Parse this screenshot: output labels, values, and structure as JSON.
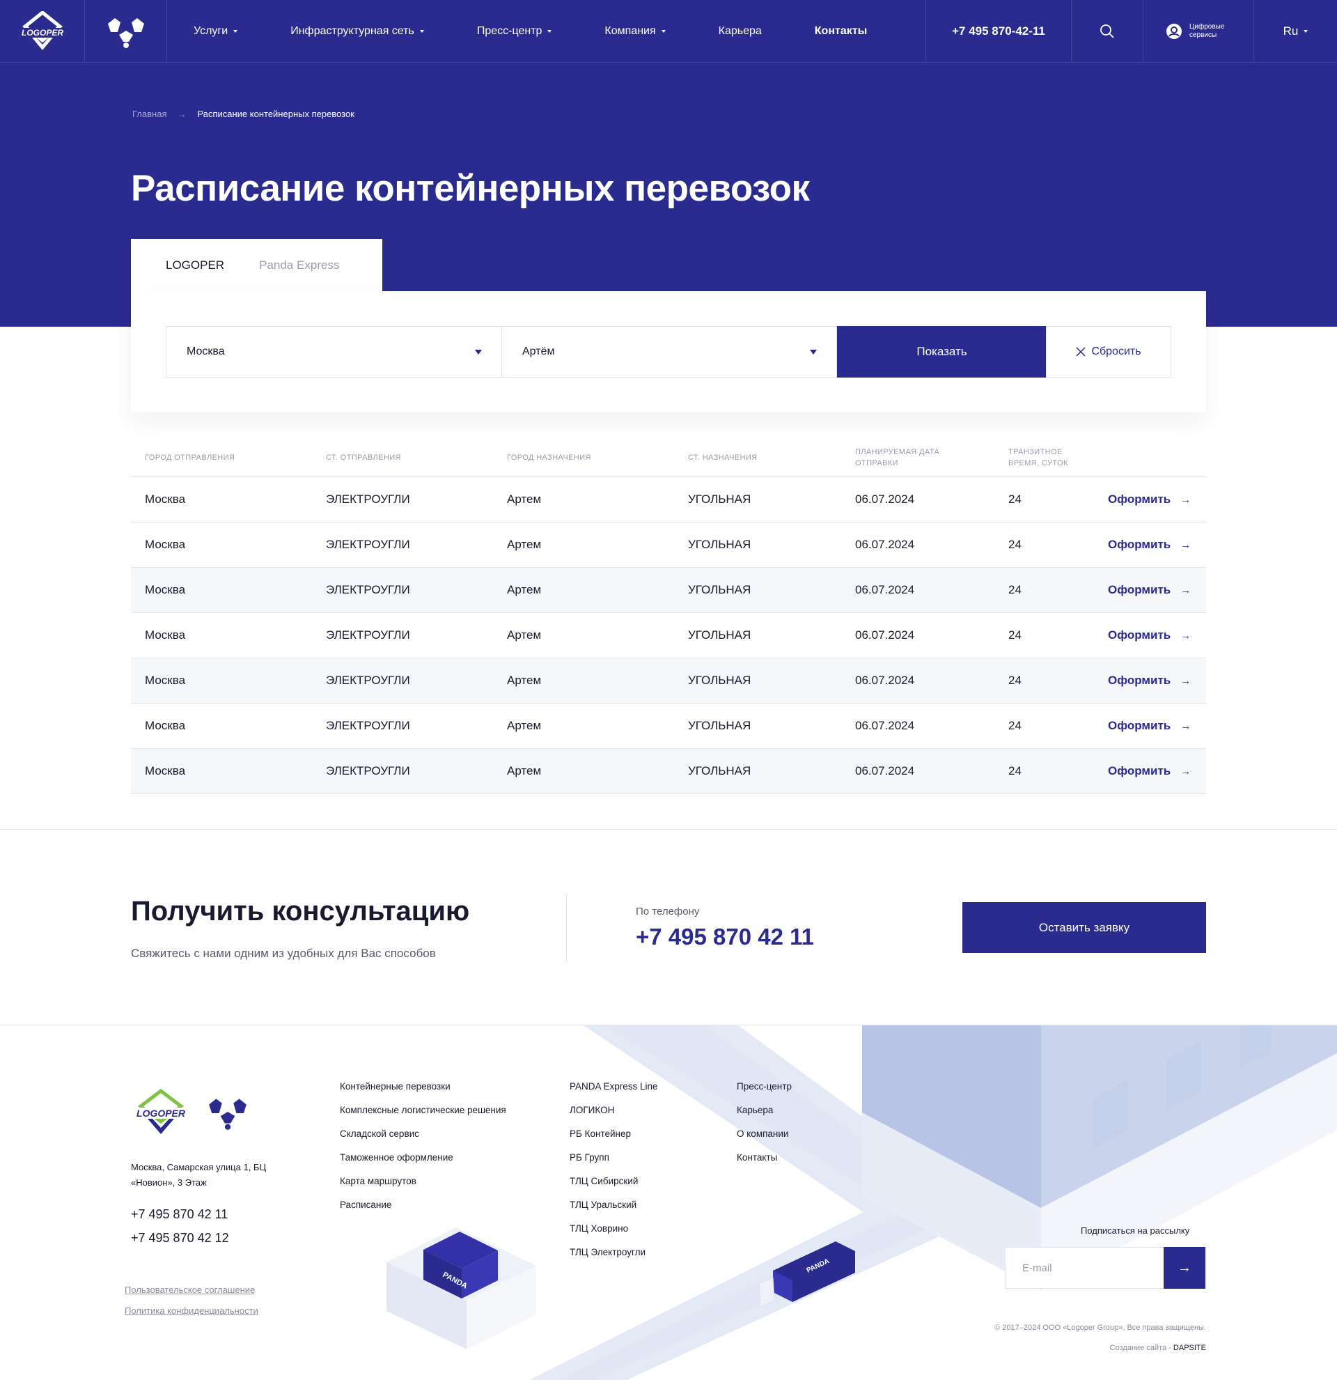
{
  "colors": {
    "brand": "#2b2a8f",
    "accent_green": "#7dc242"
  },
  "header": {
    "logo_text": "LOGOPER",
    "nav": [
      {
        "label": "Услуги",
        "dropdown": true
      },
      {
        "label": "Инфраструктурная сеть",
        "dropdown": true
      },
      {
        "label": "Пресс-центр",
        "dropdown": true
      },
      {
        "label": "Компания",
        "dropdown": true
      },
      {
        "label": "Карьера",
        "dropdown": false
      },
      {
        "label": "Контакты",
        "dropdown": false
      }
    ],
    "phone": "+7 495 870-42-11",
    "search_icon": "search-icon",
    "digital_services": "Цифровые сервисы",
    "lang": "Ru"
  },
  "breadcrumb": {
    "home": "Главная",
    "current": "Расписание контейнерных перевозок"
  },
  "page_title": "Расписание контейнерных перевозок",
  "tabs": [
    {
      "label": "LOGOPER",
      "active": true
    },
    {
      "label": "Panda Express",
      "active": false
    }
  ],
  "filter": {
    "from_value": "Москва",
    "to_value": "Артём",
    "show_label": "Показать",
    "reset_label": "Сбросить"
  },
  "table": {
    "headers": [
      "Город отправления",
      "Ст. отправления",
      "Город назначения",
      "Ст. назначения",
      "Планируемая дата отправки",
      "Транзитное время, суток"
    ],
    "action_label": "Оформить",
    "rows": [
      [
        "Москва",
        "ЭЛЕКТРОУГЛИ",
        "Артем",
        "УГОЛЬНАЯ",
        "06.07.2024",
        "24"
      ],
      [
        "Москва",
        "ЭЛЕКТРОУГЛИ",
        "Артем",
        "УГОЛЬНАЯ",
        "06.07.2024",
        "24"
      ],
      [
        "Москва",
        "ЭЛЕКТРОУГЛИ",
        "Артем",
        "УГОЛЬНАЯ",
        "06.07.2024",
        "24"
      ],
      [
        "Москва",
        "ЭЛЕКТРОУГЛИ",
        "Артем",
        "УГОЛЬНАЯ",
        "06.07.2024",
        "24"
      ],
      [
        "Москва",
        "ЭЛЕКТРОУГЛИ",
        "Артем",
        "УГОЛЬНАЯ",
        "06.07.2024",
        "24"
      ],
      [
        "Москва",
        "ЭЛЕКТРОУГЛИ",
        "Артем",
        "УГОЛЬНАЯ",
        "06.07.2024",
        "24"
      ],
      [
        "Москва",
        "ЭЛЕКТРОУГЛИ",
        "Артем",
        "УГОЛЬНАЯ",
        "06.07.2024",
        "24"
      ]
    ]
  },
  "consult": {
    "title": "Получить консультацию",
    "subtitle": "Свяжитесь с нами одним из удобных для Вас способов",
    "phone_label": "По телефону",
    "phone": "+7 495 870 42 11",
    "button": "Оставить заявку"
  },
  "footer": {
    "address": "Москва, Самарская улица 1, БЦ «Новион», 3 Этаж",
    "phones": [
      "+7 495 870 42 11",
      "+7 495 870 42 12"
    ],
    "legal": [
      "Пользовательское соглашение",
      "Политика конфиденциальности"
    ],
    "col1": [
      "Контейнерные перевозки",
      "Комплексные логистические решения",
      "Складской сервис",
      "Таможенное оформление",
      "Карта маршрутов",
      "Расписание"
    ],
    "col2": [
      "PANDA Express Line",
      "ЛОГИКОН",
      "РБ Контейнер",
      "РБ Групп",
      "ТЛЦ Сибирский",
      "ТЛЦ Уральский",
      "ТЛЦ Ховрино",
      "ТЛЦ Электроугли"
    ],
    "col3": [
      "Пресс-центр",
      "Карьера",
      "О компании",
      "Контакты"
    ],
    "subscribe_label": "Подписаться на рассылку",
    "email_placeholder": "E-mail",
    "copyright": "© 2017–2024 ООО «Logoper Group», Все права защищены.",
    "credit_prefix": "Создание сайта -",
    "credit_brand": "DAPSITE",
    "container_text": "PANDA"
  }
}
